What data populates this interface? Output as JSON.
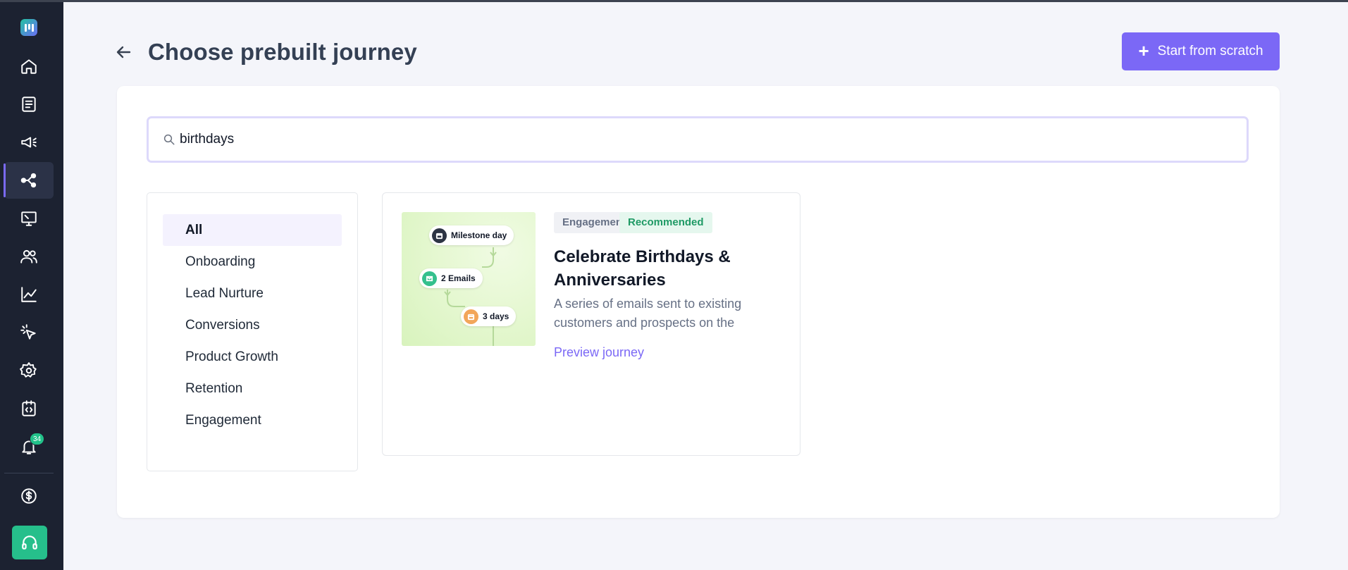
{
  "page": {
    "title": "Choose prebuilt journey",
    "start_button_label": "Start from scratch"
  },
  "sidebar": {
    "notification_count": "34",
    "items": [
      {
        "name": "home-icon"
      },
      {
        "name": "forms-icon"
      },
      {
        "name": "campaigns-icon"
      },
      {
        "name": "journeys-icon",
        "active": true
      },
      {
        "name": "web-screens-icon"
      },
      {
        "name": "contacts-icon"
      },
      {
        "name": "analytics-icon"
      },
      {
        "name": "tracking-icon"
      },
      {
        "name": "settings-icon"
      },
      {
        "name": "integrations-icon"
      },
      {
        "name": "notifications-icon"
      },
      {
        "name": "billing-icon"
      },
      {
        "name": "support-icon"
      }
    ]
  },
  "search": {
    "value": "birthdays"
  },
  "categories": {
    "items": [
      "All",
      "Onboarding",
      "Lead Nurture",
      "Conversions",
      "Product Growth",
      "Retention",
      "Engagement"
    ],
    "active": "All"
  },
  "card": {
    "tags": [
      "Engagement",
      "Recommended"
    ],
    "title": "Celebrate Birthdays & Anniversaries",
    "description": "A series of emails sent to existing customers and prospects on the",
    "link_label": "Preview journey",
    "thumbnail": {
      "step1": "Milestone day",
      "step2": "2 Emails",
      "step3": "3 days"
    }
  },
  "colors": {
    "accent": "#7b68f6",
    "sidebar_bg": "#1c2231",
    "success": "#26bf8b",
    "recommended_text": "#1f9a65"
  }
}
